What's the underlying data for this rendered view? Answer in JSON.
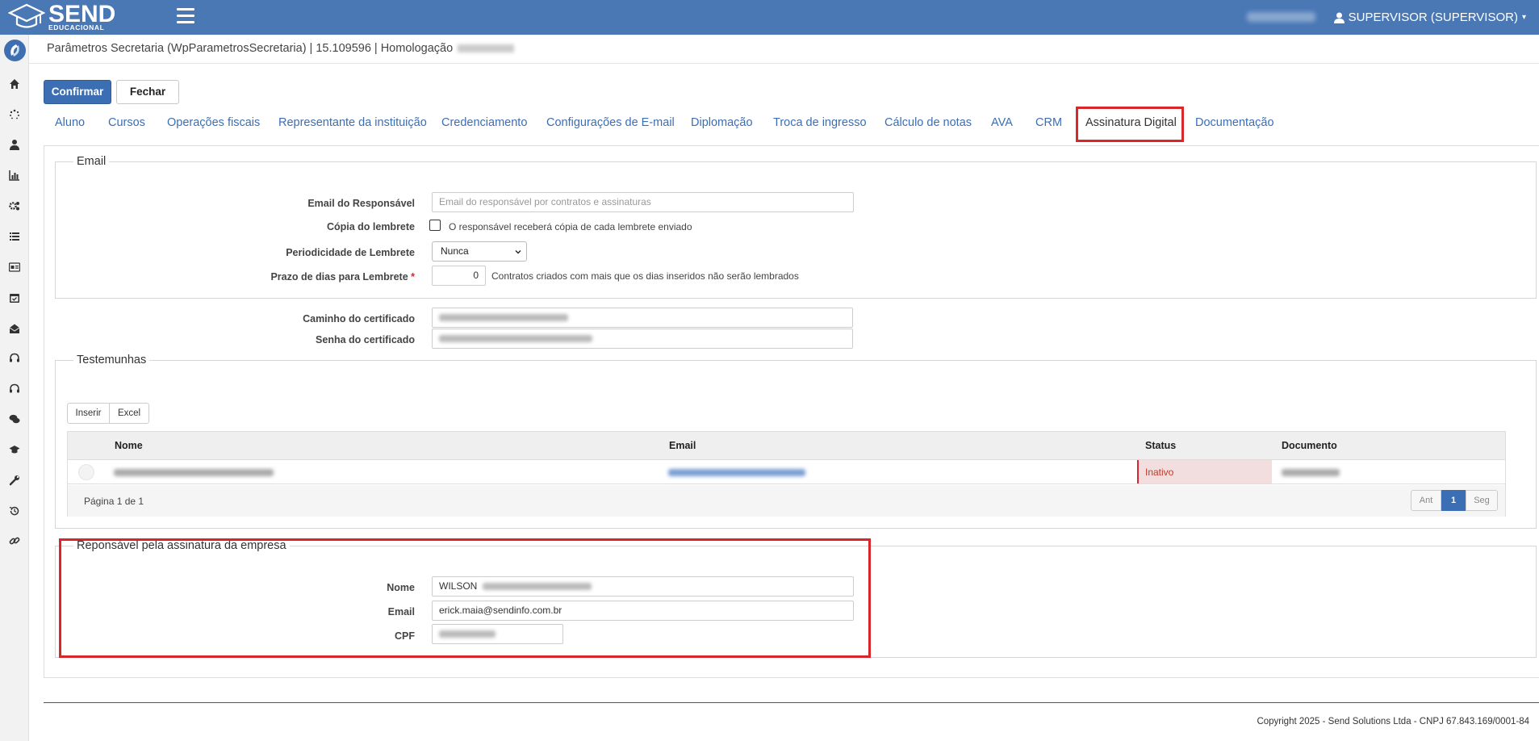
{
  "brand": {
    "name": "SEND",
    "subtitle": "EDUCACIONAL",
    "primary_color": "#4a78b5",
    "highlight_color": "#d9262c"
  },
  "user": {
    "label": "SUPERVISOR (SUPERVISOR)"
  },
  "page": {
    "title": "Parâmetros Secretaria (WpParametrosSecretaria) | 15.109596 | Homologação"
  },
  "actions": {
    "confirm": "Confirmar",
    "close": "Fechar"
  },
  "tabs": [
    {
      "label": "Aluno"
    },
    {
      "label": "Cursos"
    },
    {
      "label": "Operações fiscais"
    },
    {
      "label": "Representante da instituição"
    },
    {
      "label": "Credenciamento"
    },
    {
      "label": "Configurações de E-mail"
    },
    {
      "label": "Diplomação"
    },
    {
      "label": "Troca de ingresso"
    },
    {
      "label": "Cálculo de notas"
    },
    {
      "label": "AVA"
    },
    {
      "label": "CRM"
    },
    {
      "label": "Assinatura Digital",
      "active": true
    },
    {
      "label": "Documentação"
    }
  ],
  "email_section": {
    "legend": "Email",
    "responsavel_label": "Email do Responsável",
    "responsavel_placeholder": "Email do responsável por contratos e assinaturas",
    "copia_label": "Cópia do lembrete",
    "copia_text": "O responsável receberá cópia de cada lembrete enviado",
    "periodicidade_label": "Periodicidade de Lembrete",
    "periodicidade_value": "Nunca",
    "prazo_label": "Prazo de dias para Lembrete",
    "prazo_required": "*",
    "prazo_value": "0",
    "prazo_help": "Contratos criados com mais que os dias inseridos não serão lembrados"
  },
  "certificado": {
    "caminho_label": "Caminho do certificado",
    "senha_label": "Senha do certificado"
  },
  "testemunhas": {
    "legend": "Testemunhas",
    "insert_button": "Inserir",
    "excel_button": "Excel",
    "columns": [
      "Nome",
      "Email",
      "Status",
      "Documento"
    ],
    "rows": [
      {
        "status": "Inativo"
      }
    ],
    "page_info": "Página 1 de 1",
    "pager": {
      "prev": "Ant",
      "current": "1",
      "next": "Seg"
    }
  },
  "responsavel": {
    "legend": "Reponsável pela assinatura da empresa",
    "nome_label": "Nome",
    "nome_value": "WILSON",
    "email_label": "Email",
    "email_value": "erick.maia@sendinfo.com.br",
    "cpf_label": "CPF"
  },
  "footer": {
    "copyright": "Copyright 2025 - Send Solutions Ltda - CNPJ 67.843.169/0001-84"
  }
}
